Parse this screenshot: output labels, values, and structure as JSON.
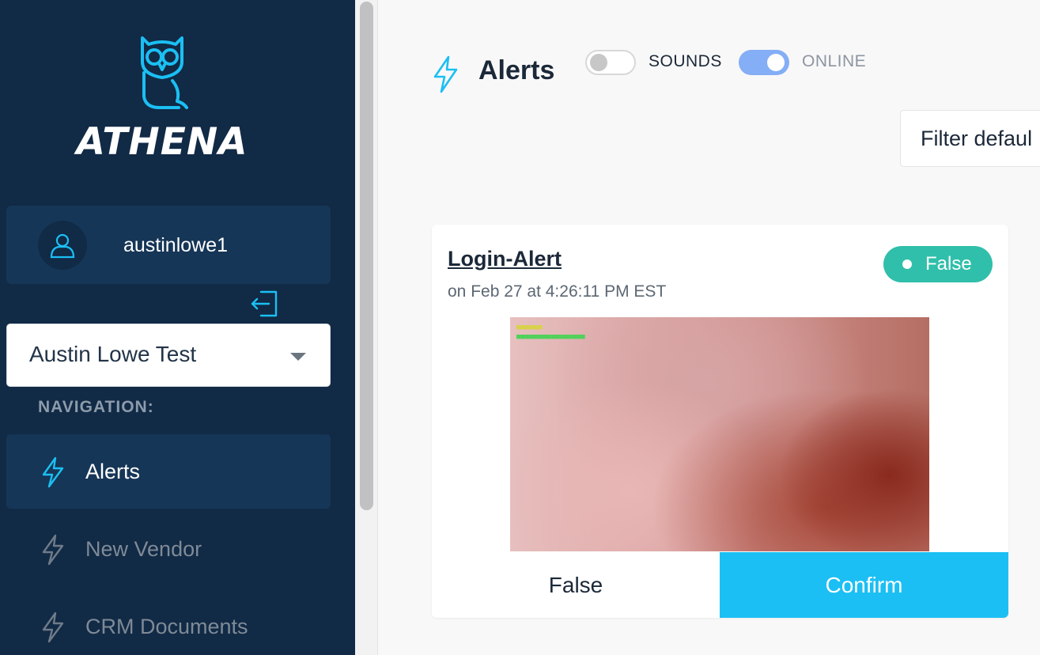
{
  "sidebar": {
    "brand": "ATHENA",
    "logo_icon": "owl-icon",
    "user": {
      "name": "austinlowe1",
      "icon": "user-icon"
    },
    "logout_icon": "logout-icon",
    "account_select": {
      "value": "Austin Lowe Test"
    },
    "nav_heading": "NAVIGATION:",
    "nav_items": [
      {
        "label": "Alerts",
        "icon": "lightning-icon",
        "active": true
      },
      {
        "label": "New Vendor",
        "icon": "lightning-icon",
        "active": false
      },
      {
        "label": "CRM Documents",
        "icon": "lightning-icon",
        "active": false
      }
    ]
  },
  "header": {
    "title": "Alerts",
    "title_icon": "lightning-icon",
    "sounds": {
      "label": "SOUNDS",
      "enabled": false
    },
    "online": {
      "label": "ONLINE",
      "enabled": true
    },
    "filter_label": "Filter defaul"
  },
  "alert": {
    "title": "Login-Alert",
    "date": "on Feb 27 at 4:26:11 PM EST",
    "status": "False",
    "false_label": "False",
    "confirm_label": "Confirm"
  },
  "colors": {
    "sidebar_bg": "#112a46",
    "accent": "#1bbff3",
    "status_green": "#2fbfaa",
    "toggle_on": "#84aef5"
  }
}
